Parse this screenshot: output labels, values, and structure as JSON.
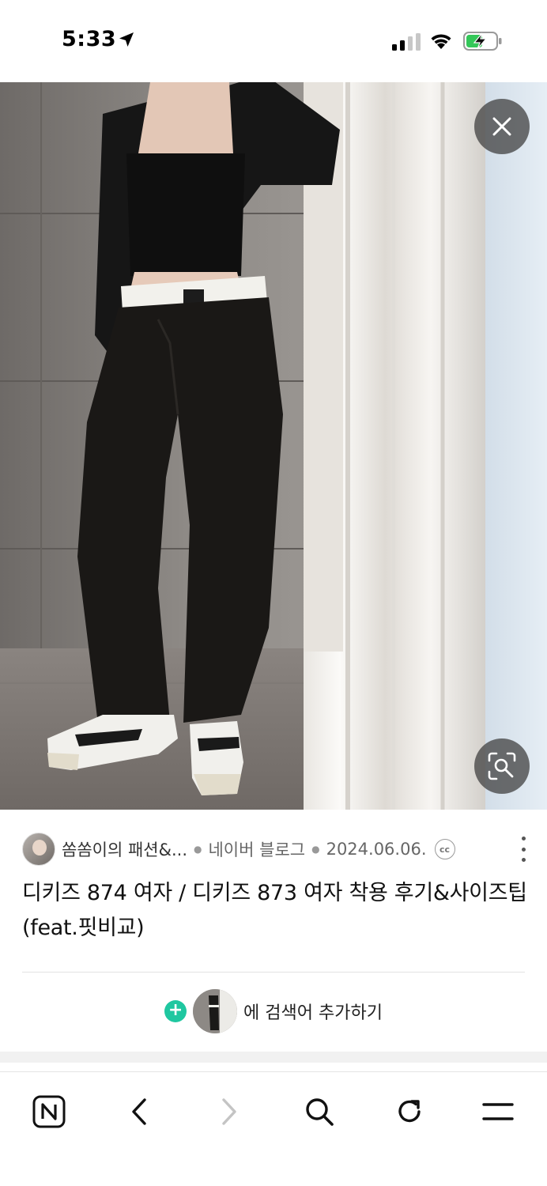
{
  "status_bar": {
    "time": "5:33",
    "icons": [
      "location-arrow-icon",
      "cellular-signal-icon",
      "wifi-icon",
      "battery-charging-icon"
    ]
  },
  "viewer": {
    "close_icon": "close-icon",
    "lens_icon": "image-search-icon"
  },
  "result": {
    "blog_name": "쏨쏨이의 패션&...",
    "source": "네이버 블로그",
    "date": "2024.06.06.",
    "cc_label": "cc",
    "title": "디키즈 874 여자 / 디키즈 873 여자 착용 후기&사이즈팁 (feat.핏비교)"
  },
  "add_search": {
    "plus": "+",
    "label": "에 검색어 추가하기"
  },
  "bottom_nav": {
    "items": [
      {
        "name": "naver-home-button",
        "icon": "naver-n-icon",
        "label": "N"
      },
      {
        "name": "back-button",
        "icon": "chevron-left-icon"
      },
      {
        "name": "forward-button",
        "icon": "chevron-right-icon"
      },
      {
        "name": "search-button",
        "icon": "search-icon"
      },
      {
        "name": "reload-button",
        "icon": "reload-icon"
      },
      {
        "name": "menu-button",
        "icon": "hamburger-menu-icon"
      }
    ]
  },
  "colors": {
    "accent_green": "#1fc7a0",
    "overlay_button": "#464646"
  }
}
